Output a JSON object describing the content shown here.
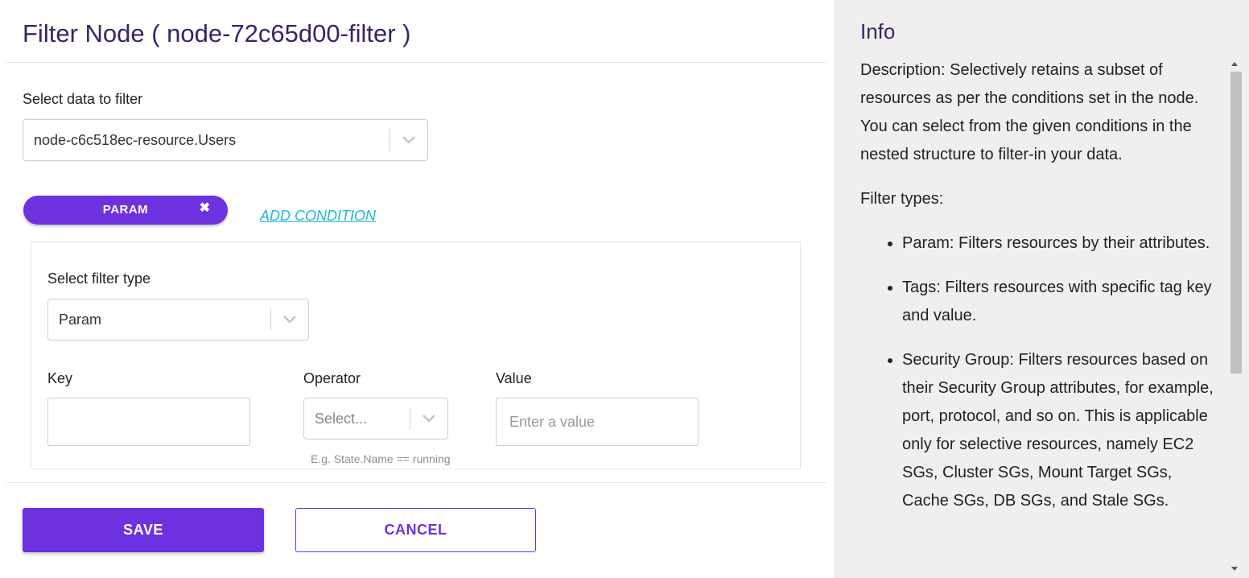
{
  "header": {
    "title": "Filter Node ( node-72c65d00-filter )"
  },
  "data_select": {
    "label": "Select data to filter",
    "value": "node-c6c518ec-resource.Users"
  },
  "condition": {
    "pill_label": "PARAM",
    "remove_glyph": "✖",
    "add_label": "ADD CONDITION",
    "filter_type_label": "Select filter type",
    "filter_type_value": "Param",
    "key_label": "Key",
    "key_value": "",
    "operator_label": "Operator",
    "operator_placeholder": "Select...",
    "operator_hint": "E.g. State.Name == running",
    "value_label": "Value",
    "value_placeholder": "Enter a value"
  },
  "actions": {
    "save_label": "SAVE",
    "cancel_label": "CANCEL"
  },
  "info": {
    "title": "Info",
    "description": "Description: Selectively retains a subset of resources as per the conditions set in the node. You can select from the given conditions in the nested structure to filter-in your data.",
    "types_heading": "Filter types:",
    "types": [
      "Param: Filters resources by their attributes.",
      "Tags: Filters resources with specific tag key and value.",
      "Security Group: Filters resources based on their Security Group attributes, for example, port, protocol, and so on. This is applicable only for selective resources, namely EC2 SGs, Cluster SGs, Mount Target SGs, Cache SGs, DB SGs, and Stale SGs."
    ]
  },
  "colors": {
    "accent": "#6d31e0",
    "title": "#3d2266",
    "link": "#1fb6d8"
  },
  "icons": {
    "dropdown": "chevron-down-icon",
    "remove": "close-icon"
  }
}
